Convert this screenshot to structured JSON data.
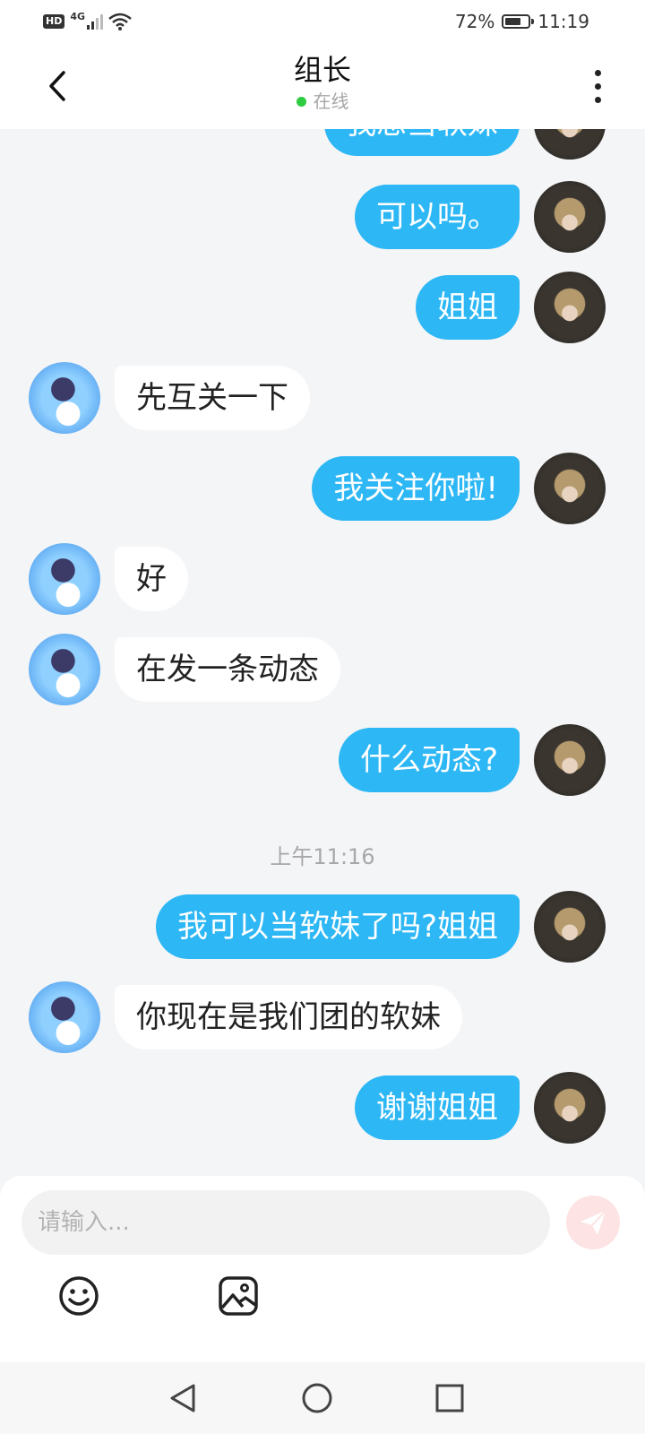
{
  "status_bar": {
    "hd": "HD",
    "network": "4G",
    "battery": "72%",
    "battery_level": 0.72,
    "time": "11:19"
  },
  "header": {
    "title": "组长",
    "status": "在线",
    "status_color": "#2ecc40"
  },
  "messages": [
    {
      "side": "self",
      "text": "可以吗。"
    },
    {
      "side": "self",
      "text": "姐姐"
    },
    {
      "side": "other",
      "text": "先互关一下"
    },
    {
      "side": "self",
      "text": "我关注你啦!"
    },
    {
      "side": "other",
      "text": "好"
    },
    {
      "side": "other",
      "text": "在发一条动态"
    },
    {
      "side": "self",
      "text": "什么动态?"
    },
    {
      "side": "self",
      "text": "我可以当软妹了吗?姐姐"
    },
    {
      "side": "other",
      "text": "你现在是我们团的软妹"
    },
    {
      "side": "self",
      "text": "谢谢姐姐"
    }
  ],
  "partial_message": {
    "side": "self",
    "text": "我想当软妹"
  },
  "timestamp": "上午11:16",
  "input": {
    "placeholder": "请输入..."
  },
  "colors": {
    "self_bubble": "#2db7f5",
    "other_bubble": "#ffffff",
    "send_button": "#fde3e3"
  },
  "icons": {
    "back": "chevron-left-icon",
    "more": "more-vertical-icon",
    "send": "send-icon",
    "emoji": "emoji-icon",
    "image": "image-icon"
  }
}
